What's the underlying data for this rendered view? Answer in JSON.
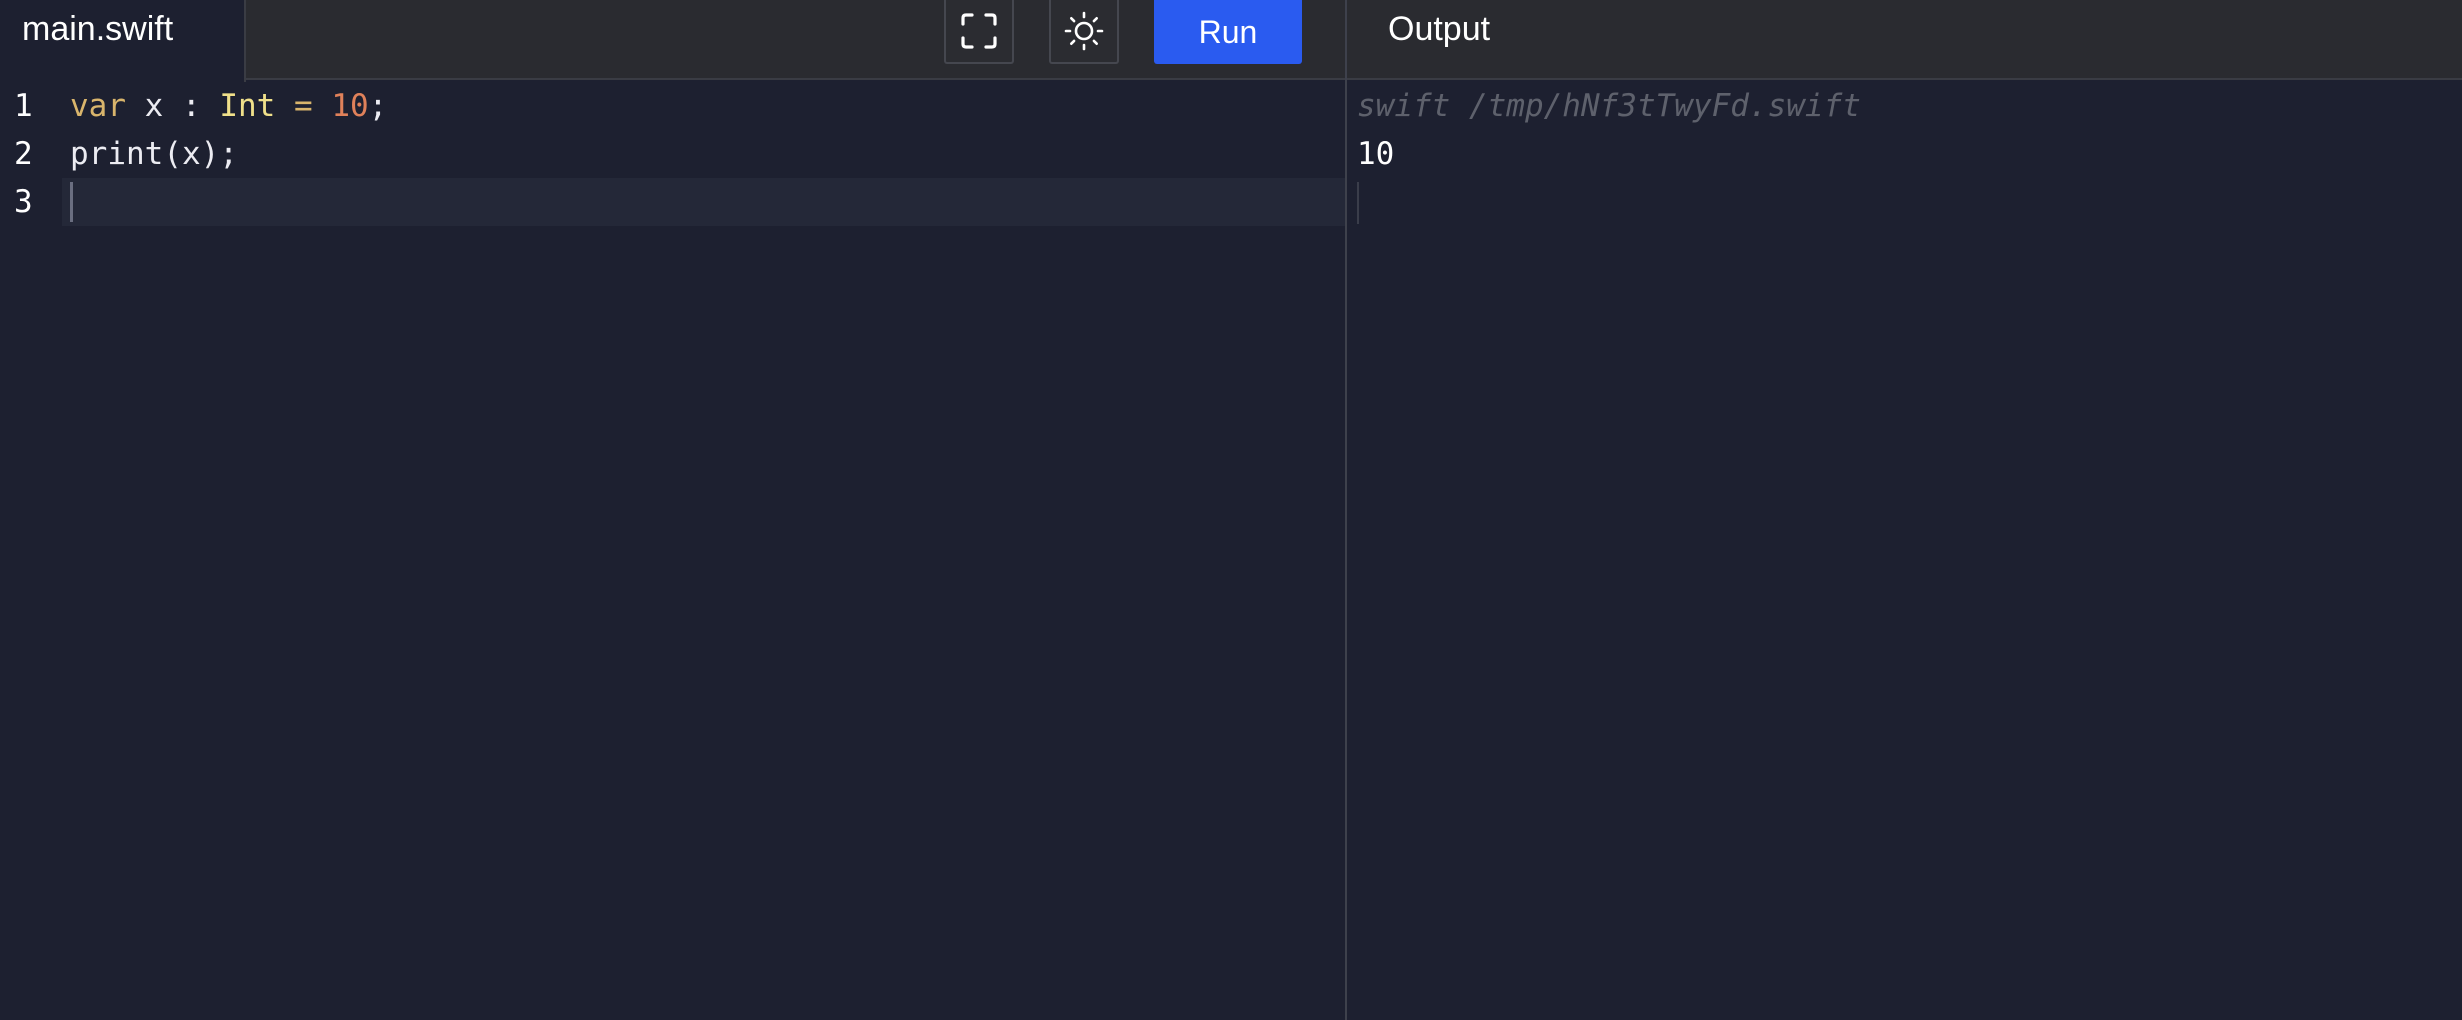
{
  "header": {
    "file_tab": "main.swift",
    "run_label": "Run",
    "output_tab": "Output",
    "fullscreen_icon": "fullscreen-icon",
    "theme_icon": "sun-icon"
  },
  "editor": {
    "lines": [
      {
        "number": "1",
        "tokens": [
          {
            "text": "var",
            "kind": "kw"
          },
          {
            "text": " x : ",
            "kind": "plain"
          },
          {
            "text": "Int",
            "kind": "type"
          },
          {
            "text": " = ",
            "kind": "op"
          },
          {
            "text": "10",
            "kind": "num"
          },
          {
            "text": ";",
            "kind": "plain"
          }
        ]
      },
      {
        "number": "2",
        "tokens": [
          {
            "text": "print(x);",
            "kind": "plain"
          }
        ]
      },
      {
        "number": "3",
        "tokens": []
      }
    ],
    "active_line": "3"
  },
  "output": {
    "command": "swift /tmp/hNf3tTwyFd.swift",
    "result": "10"
  },
  "colors": {
    "background": "#1d2030",
    "topbar": "#2a2b30",
    "run_button": "#2a5bf0",
    "keyword": "#d9b56c",
    "type": "#f0e08a",
    "number": "#e0815a",
    "command_text": "#5e616c"
  }
}
